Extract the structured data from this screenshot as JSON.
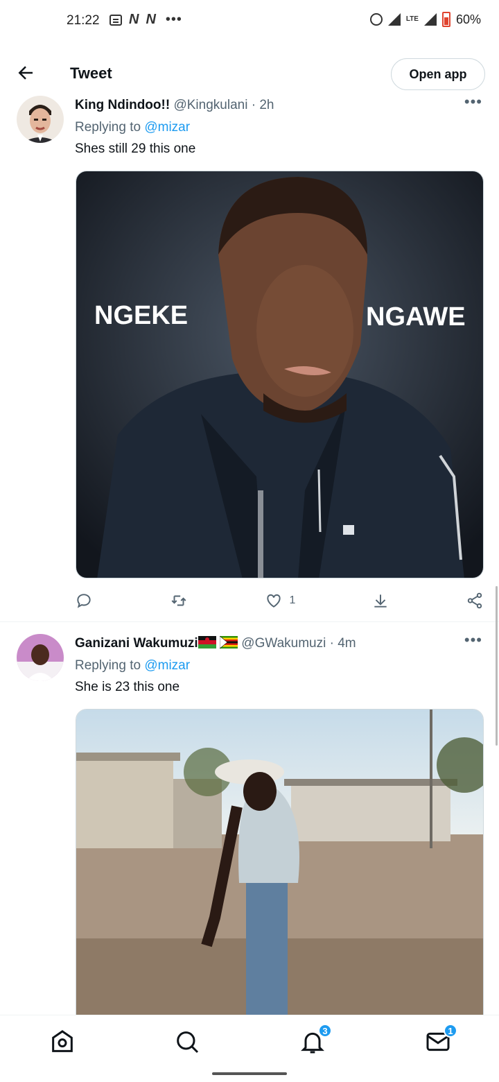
{
  "status_bar": {
    "time": "21:22",
    "left_icons": [
      "message-icon",
      "n-app-icon",
      "n-app-icon",
      "more-dots-icon"
    ],
    "lte": "LTE",
    "battery": "60%"
  },
  "header": {
    "title": "Tweet",
    "open_app": "Open app"
  },
  "tweets": [
    {
      "name": "King Ndindoo!!",
      "handle": "@Kingkulani",
      "sep": " · ",
      "time": "2h",
      "replying_prefix": "Replying to ",
      "replying_to": "@mizar",
      "text": "Shes still 29 this one",
      "image_caption_left": "NGEKE",
      "image_caption_right": "NGAWE",
      "like_count": "1"
    },
    {
      "name": "Ganizani Wakumuzi",
      "handle": "@GWakumuzi",
      "sep": " · ",
      "time": "4m",
      "replying_prefix": "Replying to ",
      "replying_to": "@mizar",
      "text": "She is 23 this one"
    }
  ],
  "bottom_nav": {
    "items": [
      "home-icon",
      "search-icon",
      "notifications-icon",
      "messages-icon"
    ],
    "notifications_badge": "3",
    "messages_badge": "1"
  },
  "colors": {
    "accent": "#1d9bf0",
    "secondary_text": "#536471",
    "divider": "#eff3f4"
  }
}
